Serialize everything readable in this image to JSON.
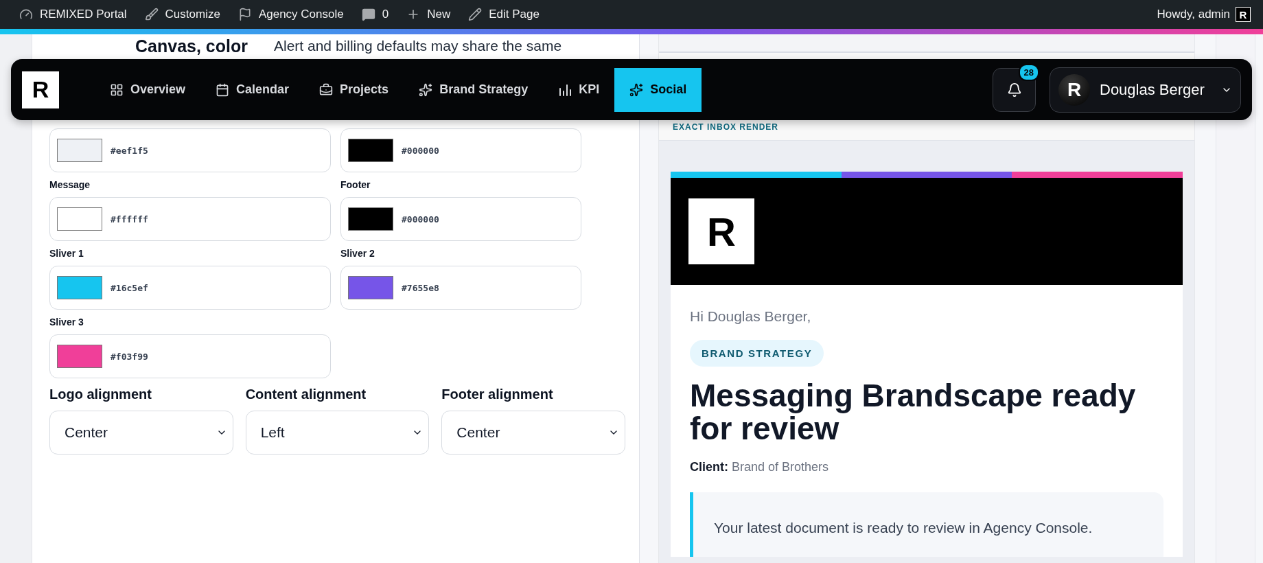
{
  "admin_bar": {
    "items": [
      {
        "kind": "dashboard",
        "label": "REMIXED Portal"
      },
      {
        "kind": "brush",
        "label": "Customize"
      },
      {
        "kind": "flag",
        "label": "Agency Console"
      },
      {
        "kind": "comment",
        "label": "0"
      },
      {
        "kind": "plus",
        "label": "New"
      },
      {
        "kind": "pencil",
        "label": "Edit Page"
      }
    ],
    "greeting": "Howdy, admin",
    "avatar": "R"
  },
  "nav": {
    "logo": "R",
    "items": [
      {
        "kind": "grid",
        "label": "Overview",
        "selected": false
      },
      {
        "kind": "calendar",
        "label": "Calendar",
        "selected": false
      },
      {
        "kind": "briefcase",
        "label": "Projects",
        "selected": false
      },
      {
        "kind": "sparkle",
        "label": "Brand Strategy",
        "selected": false
      },
      {
        "kind": "bars",
        "label": "KPI",
        "selected": false
      },
      {
        "kind": "sparkle",
        "label": "Social",
        "selected": true
      }
    ],
    "notifications": {
      "count": "28"
    },
    "user": {
      "avatar": "R",
      "name": "Douglas Berger"
    }
  },
  "settings": {
    "heading": "Canvas, color",
    "description": "Alert and billing defaults may share the same",
    "colors": [
      {
        "value": "#eef1f5",
        "color": "#eef1f5"
      },
      {
        "value": "#000000",
        "color": "#000000"
      },
      {
        "label": "Message",
        "value": "#ffffff",
        "color": "#ffffff"
      },
      {
        "label": "Footer",
        "value": "#000000",
        "color": "#000000"
      },
      {
        "label": "Sliver 1",
        "value": "#16c5ef",
        "color": "#16c5ef"
      },
      {
        "label": "Sliver 2",
        "value": "#7655e8",
        "color": "#7655e8"
      },
      {
        "label": "Sliver 3",
        "value": "#f03f99",
        "color": "#f03f99"
      }
    ],
    "alignments": [
      {
        "label": "Logo alignment",
        "value": "Center"
      },
      {
        "label": "Content alignment",
        "value": "Left"
      },
      {
        "label": "Footer alignment",
        "value": "Center"
      }
    ]
  },
  "preview": {
    "label": "EXACT INBOX RENDER",
    "slivers": [
      {
        "color": "#16c5ef"
      },
      {
        "color": "#7655e8"
      },
      {
        "color": "#f03f99"
      }
    ],
    "logo": "R",
    "greeting": "Hi Douglas Berger,",
    "badge": "BRAND STRATEGY",
    "title": "Messaging Brandscape ready for review",
    "client_label": "Client:",
    "client": "Brand of Brothers",
    "message": "Your latest document is ready to review in Agency Console."
  }
}
